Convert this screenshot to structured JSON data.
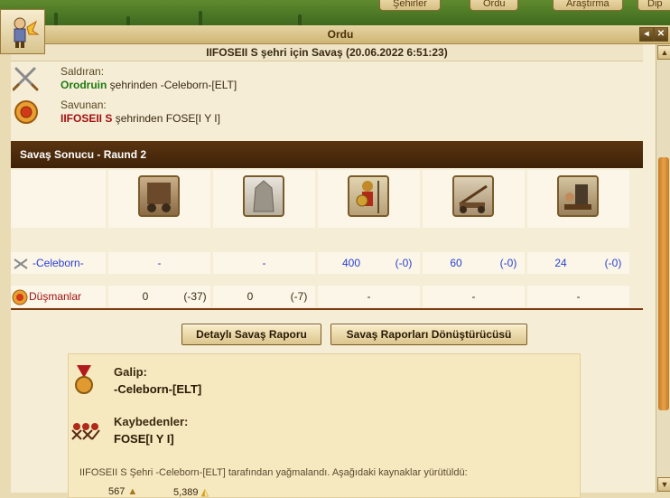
{
  "nav": {
    "tabs": [
      "Şehirler",
      "Ordu",
      "Araştırma",
      "Dip"
    ]
  },
  "window": {
    "title": "Ordu",
    "subtitle": "IIFOSEII S şehri için Savaş (20.06.2022 6:51:23)"
  },
  "attacker": {
    "label": "Saldıran:",
    "city": "Orodruin",
    "rest": " şehrinden -Celeborn-[ELT]"
  },
  "defender": {
    "label": "Savunan:",
    "city": "IIFOSEII S",
    "rest": " şehrinden FOSE[I Y I]"
  },
  "result": {
    "heading": "Savaş Sonucu - Raund 2"
  },
  "rows": {
    "attacker": {
      "name": "-Celeborn-",
      "cells": [
        {
          "v": "-",
          "d": ""
        },
        {
          "v": "-",
          "d": ""
        },
        {
          "v": "400",
          "d": "(-0)"
        },
        {
          "v": "60",
          "d": "(-0)"
        },
        {
          "v": "24",
          "d": "(-0)"
        }
      ]
    },
    "enemy": {
      "name": "Düşmanlar",
      "cells": [
        {
          "v": "0",
          "d": "(-37)"
        },
        {
          "v": "0",
          "d": "(-7)"
        },
        {
          "v": "-",
          "d": ""
        },
        {
          "v": "-",
          "d": ""
        },
        {
          "v": "-",
          "d": ""
        }
      ]
    }
  },
  "buttons": {
    "detail": "Detaylı Savaş Raporu",
    "converter": "Savaş Raporları Dönüştürücüsü"
  },
  "summary": {
    "winner_label": "Galip:",
    "winner": "-Celeborn-[ELT]",
    "losers_label": "Kaybedenler:",
    "losers": "FOSE[I Y I]",
    "plunder_text": "IIFOSEII S Şehri -Celeborn-[ELT] tarafından yağmalandı. Aşağıdaki kaynaklar yürütüldü:",
    "resources": [
      {
        "amount": "567",
        "icon": "wood-icon"
      },
      {
        "amount": "5,389",
        "icon": "sulfur-icon"
      }
    ]
  },
  "colors": {
    "accent": "#5a3410",
    "attacker_city": "#1d7a12",
    "defender_city": "#a01010",
    "units": "#2a3fd0"
  }
}
